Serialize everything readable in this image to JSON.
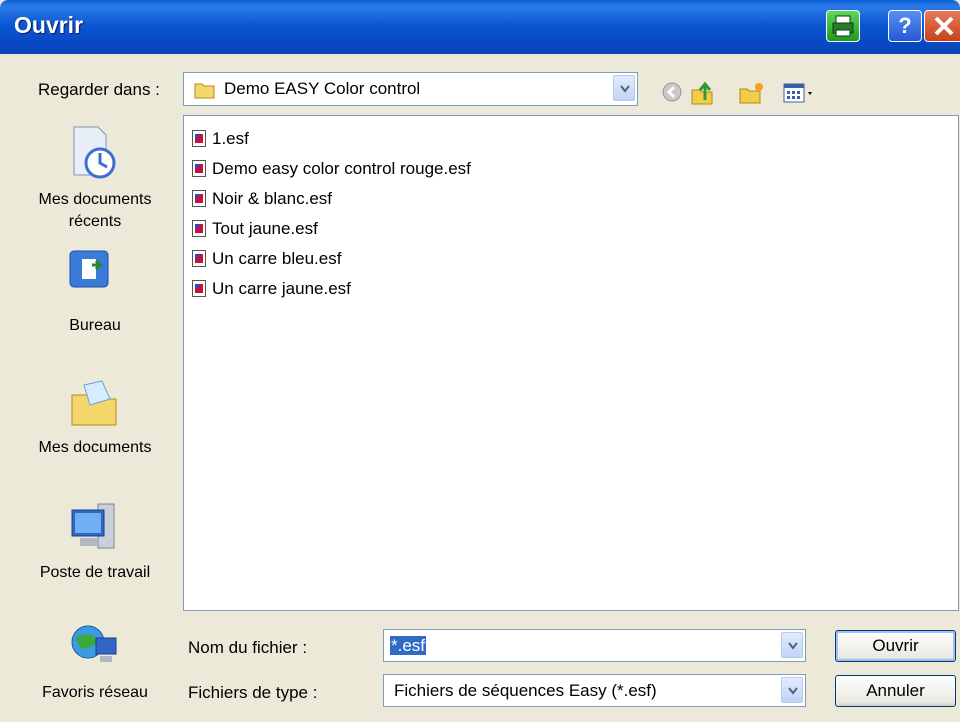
{
  "window": {
    "title": "Ouvrir"
  },
  "look_in": {
    "label": "Regarder dans :",
    "value": "Demo EASY Color control"
  },
  "toolbar": {
    "icons": [
      "back-icon",
      "up-folder-icon",
      "new-folder-icon",
      "view-menu-icon"
    ]
  },
  "places": [
    {
      "line1": "Mes documents",
      "line2": "récents",
      "icon": "recent-documents-icon"
    },
    {
      "line1": "Bureau",
      "line2": "",
      "icon": "desktop-icon"
    },
    {
      "line1": "Mes documents",
      "line2": "",
      "icon": "my-documents-icon"
    },
    {
      "line1": "Poste de travail",
      "line2": "",
      "icon": "my-computer-icon"
    },
    {
      "line1": "Favoris réseau",
      "line2": "",
      "icon": "network-places-icon"
    }
  ],
  "files": [
    {
      "name": "1.esf"
    },
    {
      "name": "Demo easy color control rouge.esf"
    },
    {
      "name": "Noir & blanc.esf"
    },
    {
      "name": "Tout jaune.esf"
    },
    {
      "name": "Un carre bleu.esf"
    },
    {
      "name": "Un carre jaune.esf"
    }
  ],
  "filename": {
    "label": "Nom du fichier :",
    "value": "*.esf"
  },
  "filetype": {
    "label": "Fichiers de type :",
    "value": "Fichiers de séquences Easy (*.esf)"
  },
  "buttons": {
    "open": "Ouvrir",
    "cancel": "Annuler"
  },
  "colors": {
    "titlebar": "#0a58d0",
    "dialog_bg": "#ece9d8",
    "selection": "#316ac5"
  }
}
